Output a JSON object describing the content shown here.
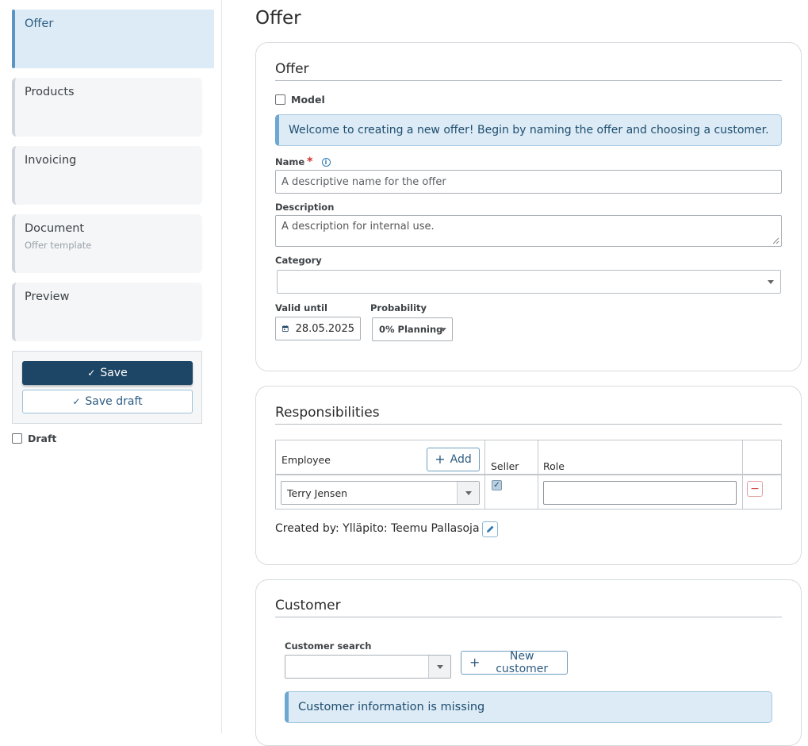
{
  "sidebar": {
    "steps": [
      {
        "label": "Offer",
        "sub": ""
      },
      {
        "label": "Products",
        "sub": ""
      },
      {
        "label": "Invoicing",
        "sub": ""
      },
      {
        "label": "Document",
        "sub": "Offer template"
      },
      {
        "label": "Preview",
        "sub": ""
      }
    ],
    "save_label": "Save",
    "save_draft_label": "Save draft",
    "draft_label": "Draft"
  },
  "page": {
    "title": "Offer"
  },
  "offer_card": {
    "title": "Offer",
    "model_label": "Model",
    "welcome": "Welcome to creating a new offer! Begin by naming the offer and choosing a customer.",
    "name_label": "Name",
    "required_mark": "*",
    "name_placeholder": "A descriptive name for the offer",
    "description_label": "Description",
    "description_placeholder": "A description for internal use.",
    "category_label": "Category",
    "category_value": "",
    "valid_until_label": "Valid until",
    "valid_until_value": "28.05.2025",
    "probability_label": "Probability",
    "probability_value": "0% Planning"
  },
  "responsibilities_card": {
    "title": "Responsibilities",
    "col_employee": "Employee",
    "add_label": "Add",
    "col_seller": "Seller",
    "col_role": "Role",
    "rows": [
      {
        "employee": "Terry Jensen",
        "seller": true,
        "role": ""
      }
    ],
    "created_by": "Created by: Ylläpito: Teemu Pallasoja"
  },
  "customer_card": {
    "title": "Customer",
    "search_label": "Customer search",
    "search_value": "",
    "new_customer_label": "New customer",
    "missing_info": "Customer information is missing"
  },
  "colors": {
    "primary": "#1d4565",
    "accent": "#2d5c82",
    "info_bg": "#dcebf6",
    "required": "#d32f2f"
  }
}
